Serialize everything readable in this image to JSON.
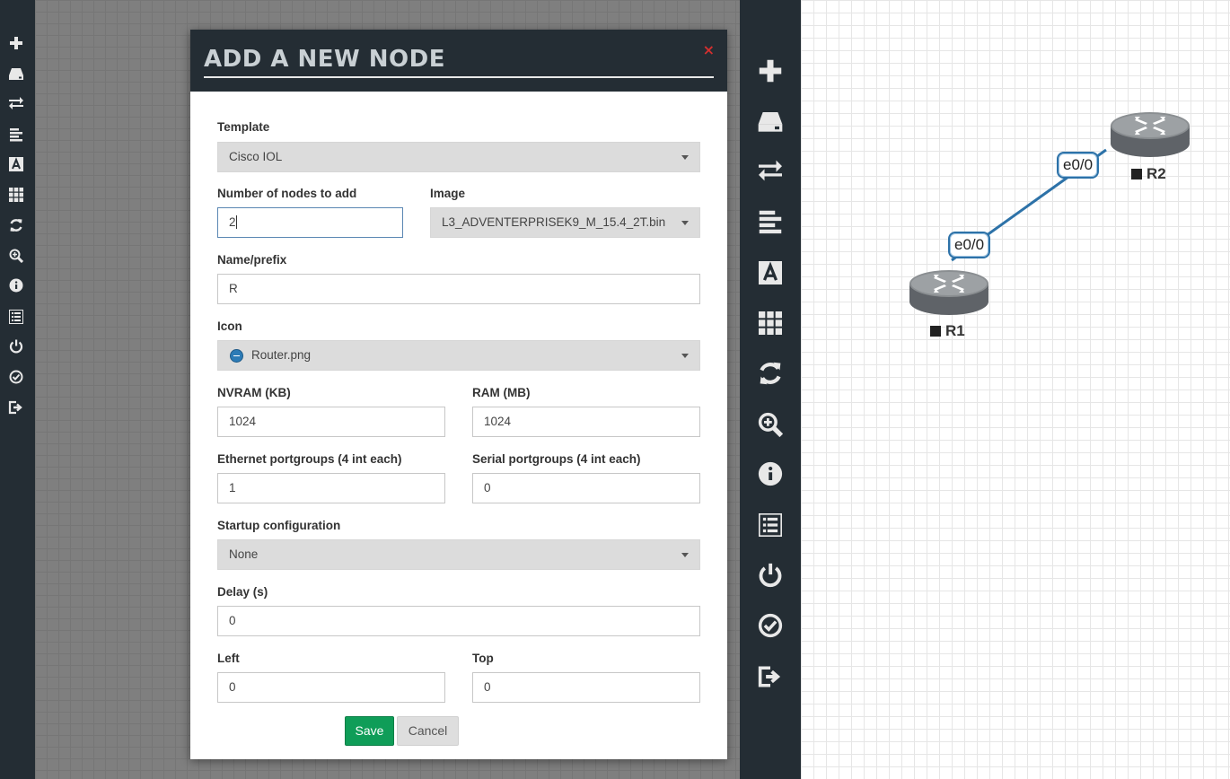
{
  "left_sidebar": {
    "icons": [
      "plus-icon",
      "storage-icon",
      "transfer-icon",
      "align-left-icon",
      "text-icon",
      "grid-icon",
      "refresh-icon",
      "zoom-in-icon",
      "info-icon",
      "list-icon",
      "power-icon",
      "check-circle-icon",
      "logout-icon"
    ]
  },
  "modal": {
    "title": "ADD A NEW NODE",
    "close_symbol": "×",
    "template": {
      "label": "Template",
      "value": "Cisco IOL"
    },
    "num_nodes": {
      "label": "Number of nodes to add",
      "value": "2"
    },
    "image": {
      "label": "Image",
      "value": "L3_ADVENTERPRISEK9_M_15.4_2T.bin"
    },
    "name_prefix": {
      "label": "Name/prefix",
      "value": "R"
    },
    "icon": {
      "label": "Icon",
      "value": "Router.png"
    },
    "nvram": {
      "label": "NVRAM (KB)",
      "value": "1024"
    },
    "ram": {
      "label": "RAM (MB)",
      "value": "1024"
    },
    "ethernet": {
      "label": "Ethernet portgroups (4 int each)",
      "value": "1"
    },
    "serial": {
      "label": "Serial portgroups (4 int each)",
      "value": "0"
    },
    "startup_config": {
      "label": "Startup configuration",
      "value": "None"
    },
    "delay": {
      "label": "Delay (s)",
      "value": "0"
    },
    "left": {
      "label": "Left",
      "value": "0"
    },
    "top": {
      "label": "Top",
      "value": "0"
    },
    "save_label": "Save",
    "cancel_label": "Cancel"
  },
  "right_sidebar": {
    "icons": [
      "plus-icon",
      "storage-icon",
      "transfer-icon",
      "align-left-icon",
      "text-icon",
      "grid-icon",
      "refresh-icon",
      "zoom-in-icon",
      "info-icon",
      "list-icon",
      "power-icon",
      "check-circle-icon",
      "logout-icon"
    ]
  },
  "topology": {
    "nodes": [
      {
        "name": "R1",
        "icon": "router-icon"
      },
      {
        "name": "R2",
        "icon": "router-icon"
      }
    ],
    "link": {
      "port_a": "e0/0",
      "port_b": "e0/0"
    },
    "colors": {
      "link": "#2d72a8",
      "router_body": "#5f6368"
    }
  }
}
